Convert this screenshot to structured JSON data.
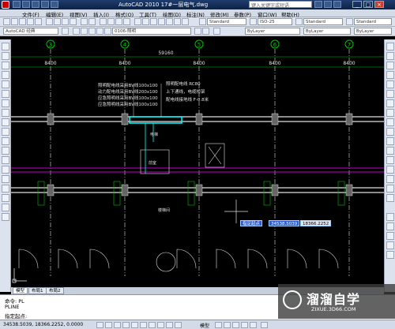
{
  "window": {
    "title": "AutoCAD 2010  17#一层电气.dwg",
    "search_placeholder": "键入关键字或短语"
  },
  "menu": [
    "文件(F)",
    "编辑(E)",
    "视图(V)",
    "插入(I)",
    "格式(O)",
    "工具(T)",
    "绘图(D)",
    "标注(N)",
    "修改(M)",
    "参数(P)",
    "窗口(W)",
    "帮助(H)"
  ],
  "toolbar": {
    "workspace": "AutoCAD 经典",
    "layer": "0106-照明",
    "text_style": "Standard",
    "dim_style": "ISO-25",
    "table_style": "Standard",
    "color": "ByLayer",
    "linetype": "ByLayer",
    "lineweight": "ByLayer",
    "plot_style": "ByColor"
  },
  "drawing": {
    "grid_numbers": [
      "3",
      "4",
      "5",
      "6",
      "7"
    ],
    "total_dim": "59160",
    "span_dims": [
      "8400",
      "8400",
      "8400",
      "8400",
      "8400"
    ],
    "legend_left": [
      "照明配电线采用BV线100x100",
      "动力配电线采用BV线200x100",
      "应急照明线采用BV线100x100",
      "应急照明线采用BV线100x100"
    ],
    "legend_right": [
      "照明配电线 RC80",
      "上下通线，电缆桥架",
      "配电线接地线 F-0.8米"
    ],
    "room_labels": [
      "电梯",
      "前室",
      "楼梯间"
    ],
    "dyn_prompt": "指定起点",
    "dyn_x": "34538.5039",
    "dyn_y": "18366.2252"
  },
  "tabs": [
    "模型",
    "布局1",
    "布局2"
  ],
  "command": {
    "line1": "命令: PL",
    "line2": "PLINE",
    "line3": "指定起点:"
  },
  "status": {
    "coords": "34538.5039, 18366.2252, 0.0000",
    "model_label": "模型"
  },
  "watermark": {
    "brand": "溜溜自学",
    "url": "ZIXUE.3D66.COM"
  },
  "colors": {
    "accent": "#1e3c6e",
    "grid_green": "#00c000",
    "axis_white": "#e0e0e0",
    "cyan": "#00ffff",
    "magenta": "#c000c0"
  }
}
